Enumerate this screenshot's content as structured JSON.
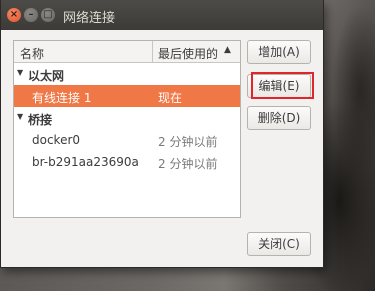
{
  "window": {
    "title": "网络连接",
    "buttons": {
      "close": "×",
      "minimize": "–",
      "maximize": "□"
    }
  },
  "list": {
    "columns": {
      "name": "名称",
      "last_used": "最后使用的"
    },
    "sort_icon": "▲",
    "groups": [
      {
        "label": "以太网",
        "expander": "▼",
        "connections": [
          {
            "name": "有线连接 1",
            "last_used": "现在",
            "selected": true
          }
        ]
      },
      {
        "label": "桥接",
        "expander": "▼",
        "connections": [
          {
            "name": "docker0",
            "last_used": "2 分钟以前"
          },
          {
            "name": "br-b291aa23690a",
            "last_used": "2 分钟以前"
          }
        ]
      }
    ]
  },
  "actions": {
    "add": "增加(A)",
    "edit": "编辑(E)",
    "delete": "删除(D)",
    "close": "关闭(C)"
  },
  "colors": {
    "selection": "#f07746",
    "highlight_box": "#e2252b"
  }
}
